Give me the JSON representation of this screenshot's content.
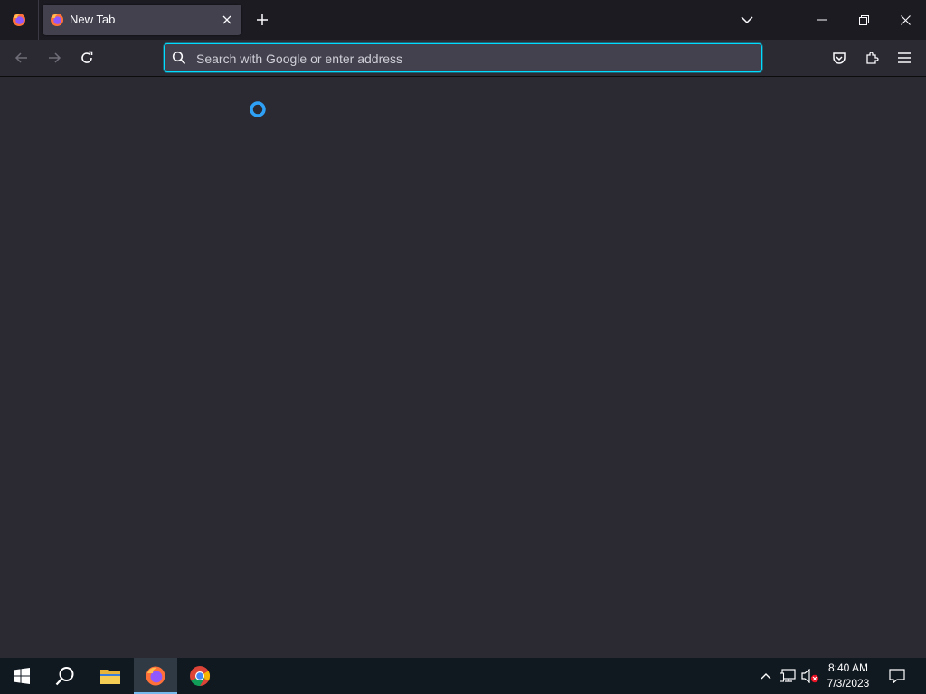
{
  "browser": {
    "tab": {
      "title": "New Tab"
    },
    "urlbar": {
      "placeholder": "Search with Google or enter address",
      "value": ""
    },
    "content": {
      "state": "loading"
    }
  },
  "taskbar": {
    "apps": [
      "start",
      "search",
      "file-explorer",
      "firefox",
      "chrome"
    ],
    "active_app": "firefox",
    "clock": {
      "time": "8:40 AM",
      "date": "7/3/2023"
    }
  },
  "colors": {
    "tabstrip_bg": "#1c1b22",
    "toolbar_bg": "#2b2a33",
    "selected_tab_bg": "#42414d",
    "urlbar_focus": "#00ddff",
    "taskbar_bg": "#101820",
    "spinner": "#2ea1f7"
  }
}
